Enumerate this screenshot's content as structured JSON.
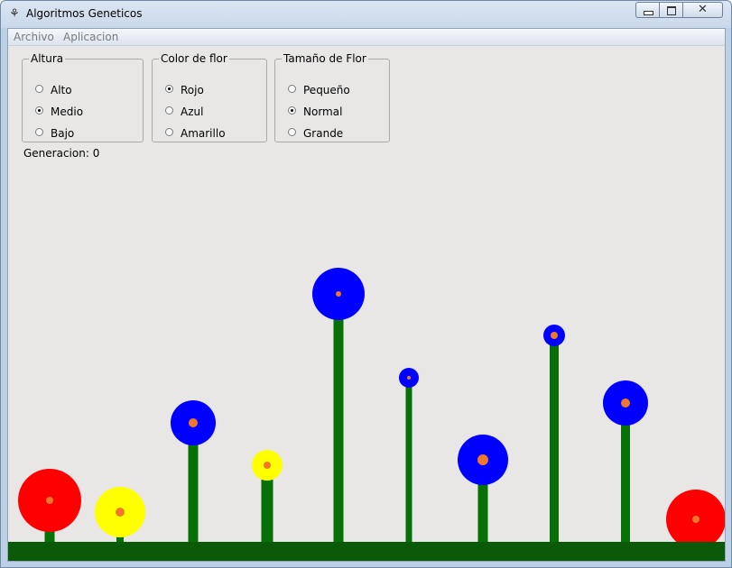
{
  "window": {
    "title": "Algoritmos Geneticos",
    "app_icon": "generic-app-icon"
  },
  "menu": {
    "items": [
      "Archivo",
      "Aplicacion"
    ]
  },
  "groups": {
    "altura": {
      "title": "Altura",
      "options": [
        "Alto",
        "Medio",
        "Bajo"
      ],
      "selected": "Medio"
    },
    "color": {
      "title": "Color de flor",
      "options": [
        "Rojo",
        "Azul",
        "Amarillo"
      ],
      "selected": "Rojo"
    },
    "size": {
      "title": "Tamaño de Flor",
      "options": [
        "Pequeño",
        "Normal",
        "Grande"
      ],
      "selected": "Normal"
    }
  },
  "generation_label": "Generacion: 0",
  "colors": {
    "ground": "#0a5a0a",
    "stem": "#077107",
    "red": "#ff0000",
    "blue": "#0000ff",
    "yellow": "#ffff00",
    "center": "#f07828"
  },
  "flowers": [
    {
      "color": "red",
      "height": "low",
      "size": "large"
    },
    {
      "color": "yellow",
      "height": "low",
      "size": "large"
    },
    {
      "color": "blue",
      "height": "medium",
      "size": "medium"
    },
    {
      "color": "yellow",
      "height": "medium",
      "size": "small"
    },
    {
      "color": "blue",
      "height": "high",
      "size": "large"
    },
    {
      "color": "blue",
      "height": "high",
      "size": "small"
    },
    {
      "color": "blue",
      "height": "medium",
      "size": "large"
    },
    {
      "color": "blue",
      "height": "high",
      "size": "small"
    },
    {
      "color": "blue",
      "height": "medium",
      "size": "medium"
    },
    {
      "color": "red",
      "height": "low",
      "size": "large"
    }
  ]
}
